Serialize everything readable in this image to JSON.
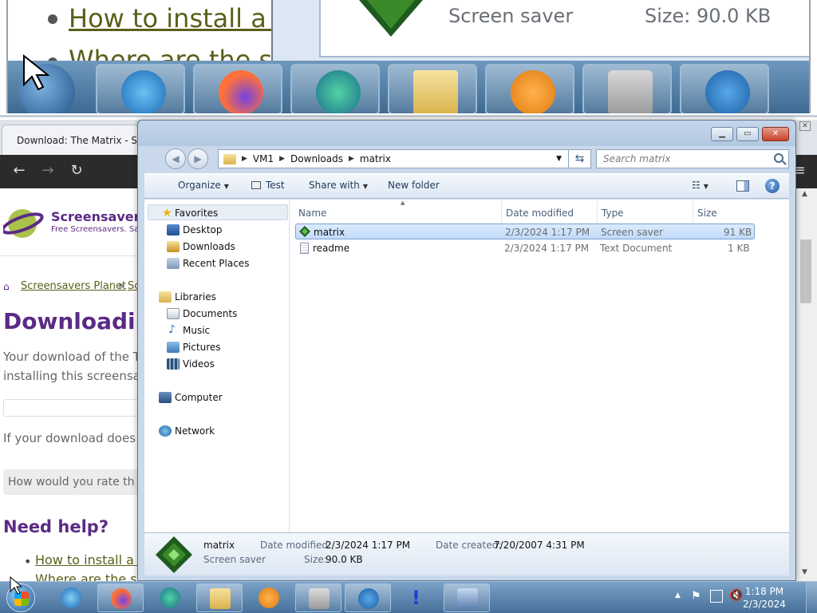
{
  "magnifier": {
    "link_1": "How to install a sc",
    "link_2": "Where are the scr",
    "detail_label": "Screen saver",
    "detail_size": "Size: 90.0 KB"
  },
  "browser": {
    "tab_title": "Download: The Matrix - Sc",
    "site_name": "Screensavers",
    "site_tagline": "Free Screensavers. Saf",
    "breadcrumb_home": "Screensavers Planet",
    "breadcrumb_sep": "»",
    "breadcrumb_next": "Sc",
    "heading": "Downloading",
    "para_1a": "Your download of the T",
    "para_1b": "installing this screensav",
    "para_2": "If your download does n",
    "rating_prompt": "How would you rate th",
    "help_heading": "Need help?",
    "help_link_1": "How to install a sc",
    "help_link_2": "Where are the scr"
  },
  "explorer": {
    "address": {
      "crumbs": [
        "VM1",
        "Downloads",
        "matrix"
      ]
    },
    "search_placeholder": "Search matrix",
    "commands": {
      "organize": "Organize",
      "test": "Test",
      "share_with": "Share with",
      "new_folder": "New folder"
    },
    "nav": {
      "favorites": "Favorites",
      "desktop": "Desktop",
      "downloads": "Downloads",
      "recent_places": "Recent Places",
      "libraries": "Libraries",
      "documents": "Documents",
      "music": "Music",
      "pictures": "Pictures",
      "videos": "Videos",
      "computer": "Computer",
      "network": "Network"
    },
    "columns": {
      "name": "Name",
      "date_modified": "Date modified",
      "type": "Type",
      "size": "Size"
    },
    "files": [
      {
        "name": "matrix",
        "date": "2/3/2024 1:17 PM",
        "type": "Screen saver",
        "size": "91 KB"
      },
      {
        "name": "readme",
        "date": "2/3/2024 1:17 PM",
        "type": "Text Document",
        "size": "1 KB"
      }
    ],
    "details": {
      "name": "matrix",
      "kind": "Screen saver",
      "date_modified_label": "Date modified:",
      "date_modified": "2/3/2024 1:17 PM",
      "size_label": "Size:",
      "size": "90.0 KB",
      "date_created_label": "Date created:",
      "date_created": "7/20/2007 4:31 PM"
    }
  },
  "taskbar": {
    "time": "1:18 PM",
    "date": "2/3/2024"
  },
  "colors": {
    "accent_purple": "#5b2a86",
    "link_olive": "#5a5f1a",
    "taskbar_blue": "#46709a",
    "selection": "#c1dbfc"
  }
}
